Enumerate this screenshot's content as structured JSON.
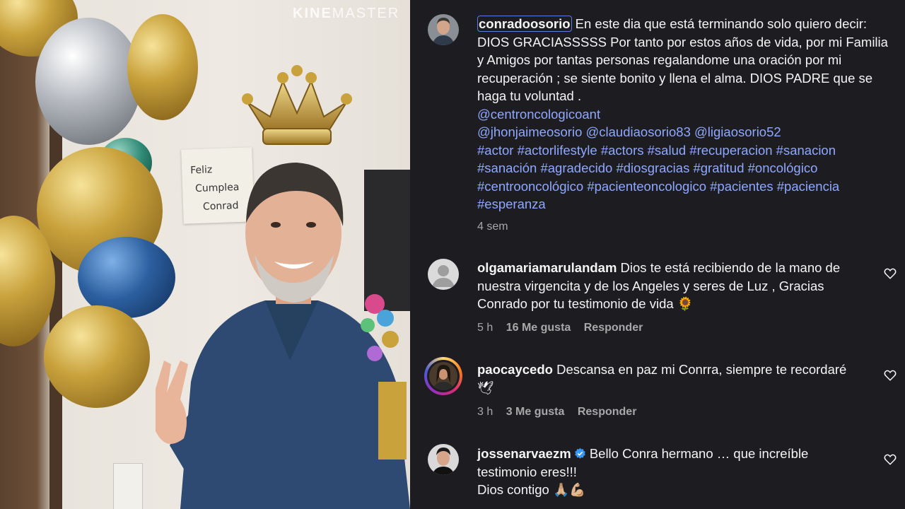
{
  "watermark": "KINEMASTER",
  "note": {
    "line1": "Feliz",
    "line2": "Cumplea",
    "line3": "Conrad"
  },
  "caption": {
    "username": "conradoosorio",
    "text": "En este dia que está terminando solo quiero decir: DIOS GRACIASSSSS Por tanto por estos años de vida, por mi Familia y Amigos por tantas personas regalandome una oración por mi recuperación ; se siente bonito y llena el alma. DIOS PADRE que se haga tu voluntad .",
    "mention1": "@centroncologicoant",
    "mentions2": [
      "@jhonjaimeosorio",
      "@claudiaosorio83",
      "@ligiaosorio52"
    ],
    "hashtags": [
      "#actor",
      "#actorlifestyle",
      "#actors",
      "#salud",
      "#recuperacion",
      "#sanacion",
      "#sanación",
      "#agradecido",
      "#diosgracias",
      "#gratitud",
      "#oncológico",
      "#centrooncológico",
      "#pacienteoncologico",
      "#pacientes",
      "#paciencia",
      "#esperanza"
    ],
    "time": "4 sem"
  },
  "comments": [
    {
      "username": "olgamariamarulandam",
      "text": "Dios te está recibiendo de la mano de nuestra virgencita y de los Angeles y seres de Luz , Gracias Conrado por tu testimonio de vida 🌻",
      "time": "5 h",
      "likes": "16 Me gusta",
      "reply": "Responder"
    },
    {
      "username": "paocaycedo",
      "text": "Descansa en paz mi Conrra, siempre te recordaré 🕊",
      "time": "3 h",
      "likes": "3 Me gusta",
      "reply": "Responder"
    },
    {
      "username": "jossenarvaezm",
      "text": "Bello Conra hermano … que increíble testimonio eres!!!",
      "text2": "Dios contigo 🙏🏼💪🏼"
    }
  ],
  "colors": {
    "background": "#1c1c21",
    "link": "#8fa8ff",
    "muted": "#a8a8a8",
    "verified": "#3897f0"
  }
}
